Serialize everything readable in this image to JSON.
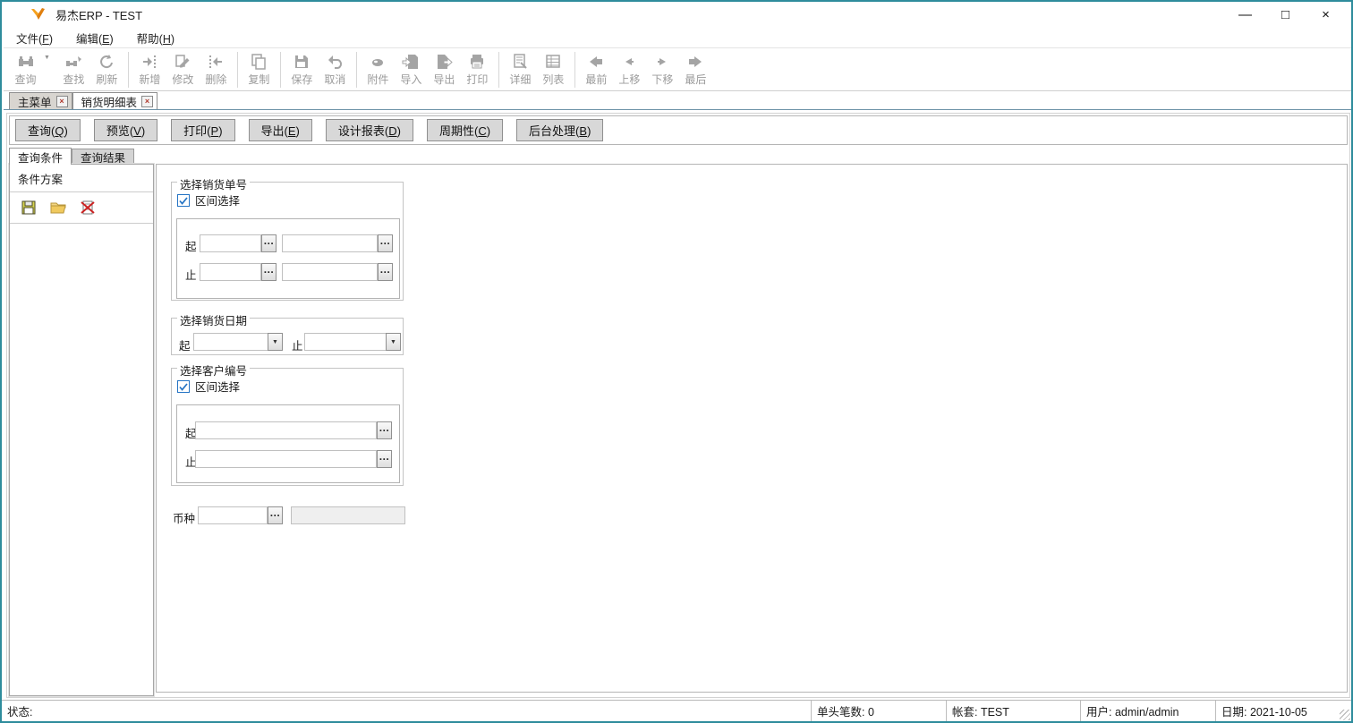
{
  "window": {
    "title": "易杰ERP - TEST"
  },
  "titlebar_controls": [
    {
      "name": "minimize",
      "glyph": "—"
    },
    {
      "name": "maximize",
      "glyph": "□"
    },
    {
      "name": "close",
      "glyph": "×"
    }
  ],
  "menubar": {
    "items": [
      {
        "id": "file",
        "label": "文件(F)"
      },
      {
        "id": "edit",
        "label": "编辑(E)"
      },
      {
        "id": "help",
        "label": "帮助(H)"
      }
    ]
  },
  "toolbar": {
    "items": [
      {
        "id": "query",
        "label": "查询",
        "icon": "query-binoculars-icon",
        "dropdown": true
      },
      {
        "id": "find",
        "label": "查找",
        "icon": "find-icon"
      },
      {
        "id": "refresh",
        "label": "刷新",
        "icon": "refresh-icon",
        "sep_after": true
      },
      {
        "id": "add",
        "label": "新增",
        "icon": "add-record-icon"
      },
      {
        "id": "modify",
        "label": "修改",
        "icon": "modify-record-icon"
      },
      {
        "id": "delete",
        "label": "删除",
        "icon": "delete-record-icon",
        "sep_after": true
      },
      {
        "id": "copy",
        "label": "复制",
        "icon": "copy-icon",
        "sep_after": true
      },
      {
        "id": "save",
        "label": "保存",
        "icon": "save-icon"
      },
      {
        "id": "cancel",
        "label": "取消",
        "icon": "undo-icon",
        "sep_after": true
      },
      {
        "id": "attachment",
        "label": "附件",
        "icon": "attachment-icon"
      },
      {
        "id": "import",
        "label": "导入",
        "icon": "import-icon"
      },
      {
        "id": "export",
        "label": "导出",
        "icon": "export-icon"
      },
      {
        "id": "print",
        "label": "打印",
        "icon": "print-icon",
        "sep_after": true
      },
      {
        "id": "detail",
        "label": "详细",
        "icon": "detail-view-icon"
      },
      {
        "id": "list",
        "label": "列表",
        "icon": "list-view-icon",
        "sep_after": true
      },
      {
        "id": "first",
        "label": "最前",
        "icon": "first-record-icon"
      },
      {
        "id": "move-up",
        "label": "上移",
        "icon": "prev-record-icon"
      },
      {
        "id": "move-down",
        "label": "下移",
        "icon": "next-record-icon"
      },
      {
        "id": "last",
        "label": "最后",
        "icon": "last-record-icon"
      }
    ]
  },
  "main_tabs": [
    {
      "id": "main-menu",
      "label": "主菜单",
      "close_glyph": "×",
      "active": false
    },
    {
      "id": "sales-detail-report",
      "label": "销货明细表",
      "close_glyph": "×",
      "active": true
    }
  ],
  "action_buttons": [
    {
      "id": "query",
      "label": "查询(Q)"
    },
    {
      "id": "preview",
      "label": "预览(V)"
    },
    {
      "id": "print",
      "label": "打印(P)"
    },
    {
      "id": "export",
      "label": "导出(E)"
    },
    {
      "id": "design-report",
      "label": "设计报表(D)"
    },
    {
      "id": "periodic",
      "label": "周期性(C)"
    },
    {
      "id": "background-process",
      "label": "后台处理(B)"
    }
  ],
  "subtabs": [
    {
      "id": "query-condition",
      "label": "查询条件",
      "active": true
    },
    {
      "id": "query-result",
      "label": "查询结果",
      "active": false
    }
  ],
  "left_panel": {
    "title": "条件方案",
    "tools": [
      {
        "id": "save-scheme",
        "icon": "save-scheme-icon"
      },
      {
        "id": "open-scheme",
        "icon": "open-scheme-icon"
      },
      {
        "id": "delete-scheme",
        "icon": "delete-scheme-icon"
      }
    ]
  },
  "form": {
    "sales_no": {
      "title": "选择销货单号",
      "range_checkbox": {
        "label": "区间选择",
        "checked": true
      },
      "from_label": "起",
      "to_label": "止",
      "fields": {
        "from1": "",
        "from2": "",
        "to1": "",
        "to2": ""
      }
    },
    "sales_date": {
      "title": "选择销货日期",
      "from_label": "起",
      "to_label": "止",
      "from_value": "",
      "to_value": ""
    },
    "customer_no": {
      "title": "选择客户编号",
      "range_checkbox": {
        "label": "区间选择",
        "checked": true
      },
      "from_label": "起",
      "to_label": "止",
      "fields": {
        "from": "",
        "to": ""
      }
    },
    "currency": {
      "label": "币种",
      "code": "",
      "name": ""
    }
  },
  "icons": {
    "ellipsis": "…",
    "dropdown": "▼"
  },
  "statusbar": {
    "sections": [
      {
        "id": "status",
        "label": "状态:"
      },
      {
        "id": "header-count",
        "label": "单头笔数: 0"
      },
      {
        "id": "account-set",
        "label": "帐套: TEST"
      },
      {
        "id": "user",
        "label": "用户: admin/admin"
      },
      {
        "id": "date",
        "label": "日期: 2021-10-05"
      }
    ]
  },
  "colors": {
    "window_border": "#2e8c9c",
    "checkbox_blue": "#2574c4",
    "button_face": "#d8d8d8",
    "disabled_toolbar_text": "#9b9b9b",
    "tab_close_x": "#b03a2e"
  }
}
